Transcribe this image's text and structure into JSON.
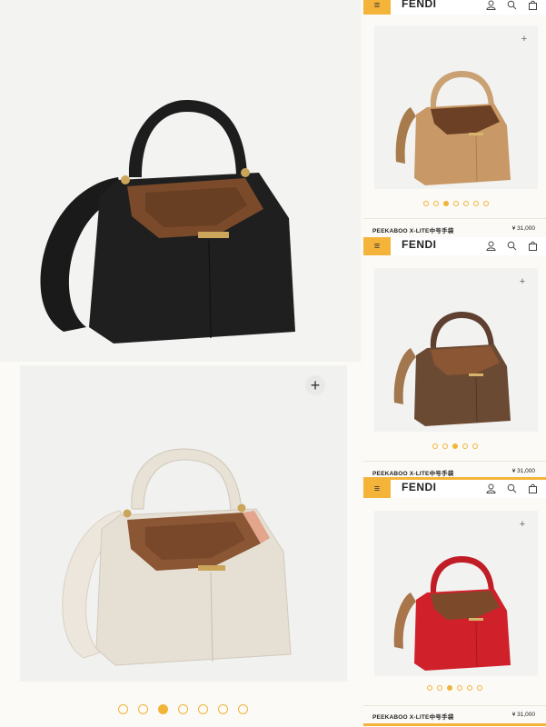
{
  "main": {
    "add_symbol": "+",
    "bags": {
      "top": {
        "color": "#1f1f1f",
        "strap_color": "#1a1a1a",
        "interior": "#7a4a2a"
      },
      "bottom": {
        "color": "#e6dfd3",
        "strap_color": "#ece6dc",
        "interior": "#8a5634"
      }
    },
    "carousel": {
      "count": 7,
      "active_index": 2,
      "accent": "#f0b537"
    }
  },
  "panels": [
    {
      "menu_icon": "≡",
      "brand": "FENDI",
      "bag_color": "#c89866",
      "strap_color": "#a87b4c",
      "add_symbol": "+",
      "carousel": {
        "count": 7,
        "active_index": 2
      },
      "product_name": "PEEKABOO X-LITE中号手袋",
      "price": "¥ 31,000"
    },
    {
      "menu_icon": "≡",
      "brand": "FENDI",
      "bag_color": "#6b4a34",
      "strap_color": "#a2774e",
      "add_symbol": "+",
      "carousel": {
        "count": 5,
        "active_index": 2
      },
      "product_name": "PEEKABOO X-LITE中号手袋",
      "price": "¥ 31,000"
    },
    {
      "menu_icon": "≡",
      "brand": "FENDI",
      "bag_color": "#d0212b",
      "strap_color": "#a8764a",
      "add_symbol": "+",
      "carousel": {
        "count": 6,
        "active_index": 2
      },
      "product_name": "PEEKABOO X-LITE中号手袋",
      "price": "¥ 31,000"
    }
  ],
  "colors": {
    "accent": "#f4b43a",
    "text": "#222222"
  }
}
